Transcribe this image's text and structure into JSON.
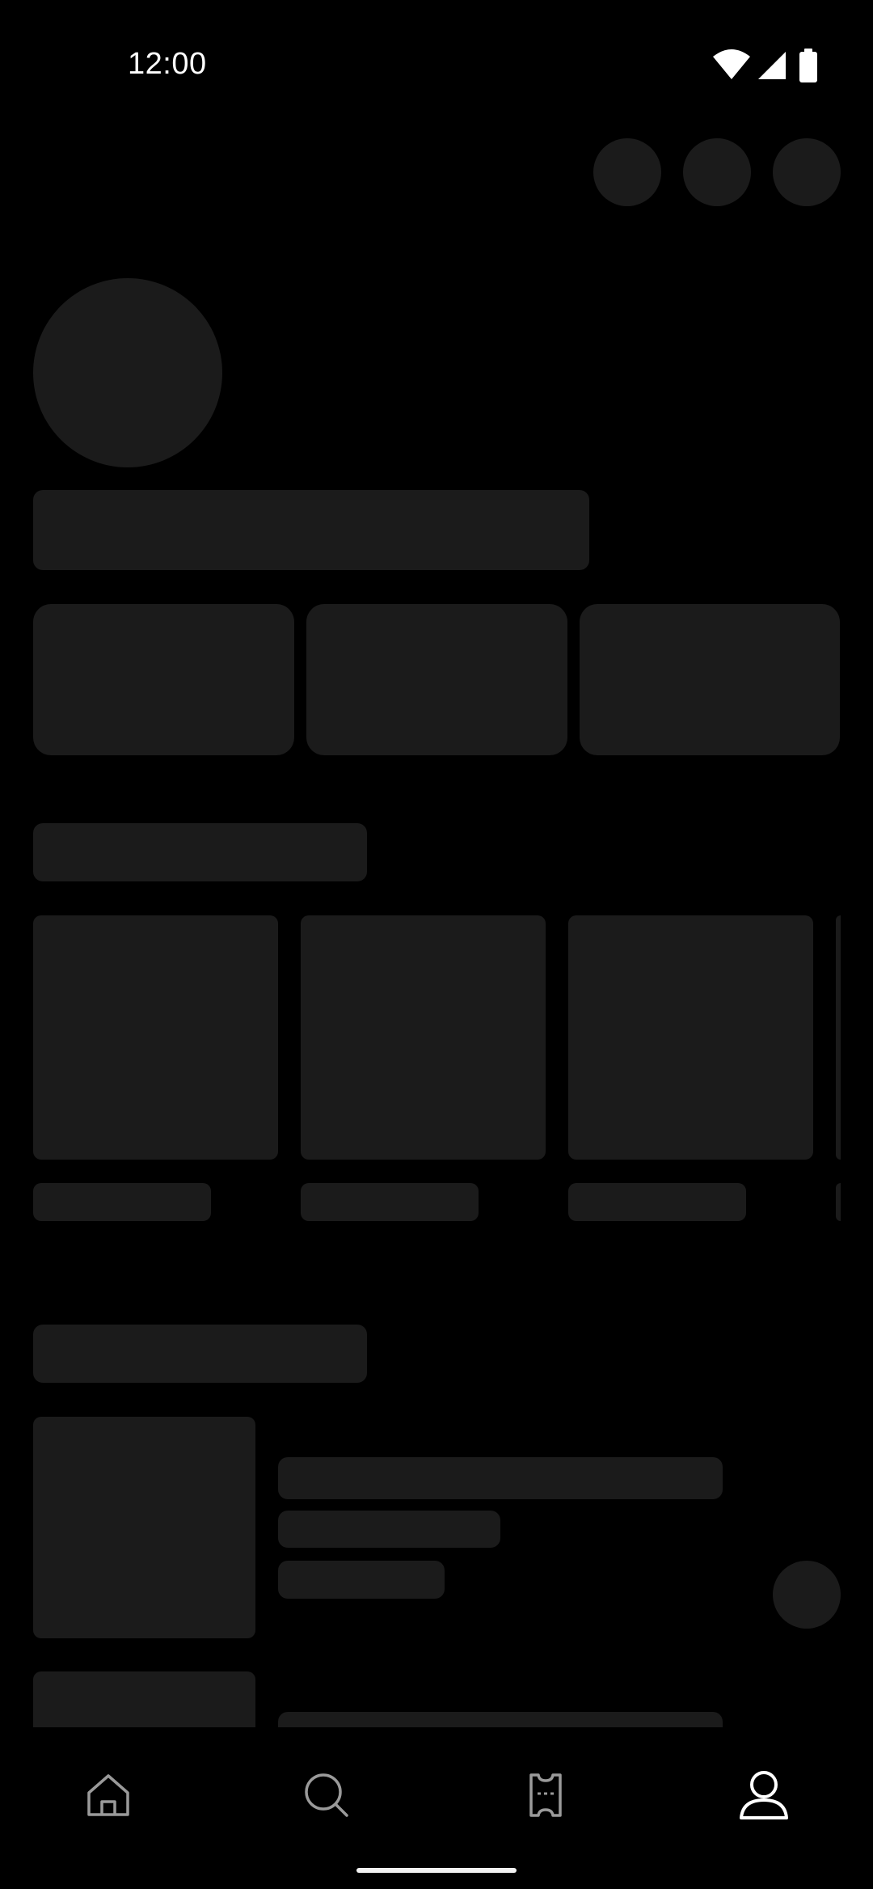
{
  "status_bar": {
    "time": "12:00",
    "icons": [
      "wifi-icon",
      "cellular-signal-icon",
      "battery-icon"
    ]
  },
  "theme": {
    "background": "#000000",
    "skeleton": "#1b1b1b",
    "icon_inactive": "#9a9a9a",
    "icon_active": "#ffffff"
  },
  "bottom_nav": {
    "items": [
      {
        "icon": "home-icon",
        "active": false
      },
      {
        "icon": "search-icon",
        "active": false
      },
      {
        "icon": "ticket-icon",
        "active": false
      },
      {
        "icon": "profile-icon",
        "active": true
      }
    ]
  }
}
